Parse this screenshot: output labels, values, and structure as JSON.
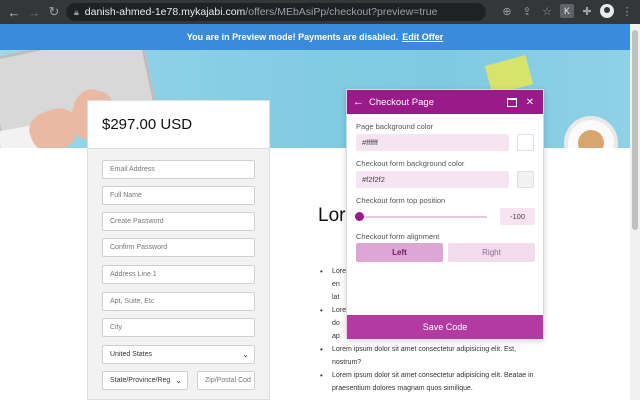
{
  "browser": {
    "url_host": "danish-ahmed-1e78.mykajabi.com",
    "url_path": "/offers/MEbAsiPp/checkout?preview=true",
    "extension_label": "K"
  },
  "banner": {
    "message": "You are in Preview mode! Payments are disabled.",
    "link_label": "Edit Offer"
  },
  "checkout": {
    "price": "$297.00 USD",
    "fields": {
      "email": "Email Address",
      "full_name": "Full Name",
      "create_password": "Create Password",
      "confirm_password": "Confirm Password",
      "address_line_1": "Address Line 1",
      "apt_suite": "Apt, Suite, Etc",
      "city": "City",
      "country": "United States",
      "state": "State/Province/Reg",
      "zip": "Zip/Postal Cod"
    }
  },
  "content": {
    "title": "Lore",
    "bullets": [
      "Lore",
      "en",
      "lat",
      "Lore",
      "do",
      "ap",
      "Lorem ipsum dolor sit amet consectetur adipisicing elit. Est,",
      "nostrum?",
      "Lorem ipsum dolor sit amet consectetur adipisicing elit. Beatae in",
      "praesentium dolores magnam quos similique."
    ]
  },
  "panel": {
    "title": "Checkout Page",
    "page_bg_label": "Page background color",
    "page_bg_value": "#ffffff",
    "form_bg_label": "Checkout form background color",
    "form_bg_value": "#f2f2f2",
    "top_position_label": "Checkout form top position",
    "top_position_value": "-100",
    "alignment_label": "Checkout form alignment",
    "align_left": "Left",
    "align_right": "Right",
    "save_label": "Save Code"
  },
  "colors": {
    "banner": "#3b8bdb",
    "panel_accent": "#9b1a8a",
    "save_button": "#b23aa1",
    "form_bg": "#f2f2f2"
  },
  "icons": {
    "back": "arrow-left-icon",
    "forward": "arrow-right-icon",
    "reload": "reload-icon",
    "lock": "lock-icon",
    "install": "install-icon",
    "share": "share-icon",
    "star": "star-icon",
    "puzzle": "extensions-icon",
    "menu": "kebab-menu-icon",
    "panel_back": "arrow-left-icon",
    "panel_window": "window-icon",
    "panel_close": "close-icon"
  }
}
